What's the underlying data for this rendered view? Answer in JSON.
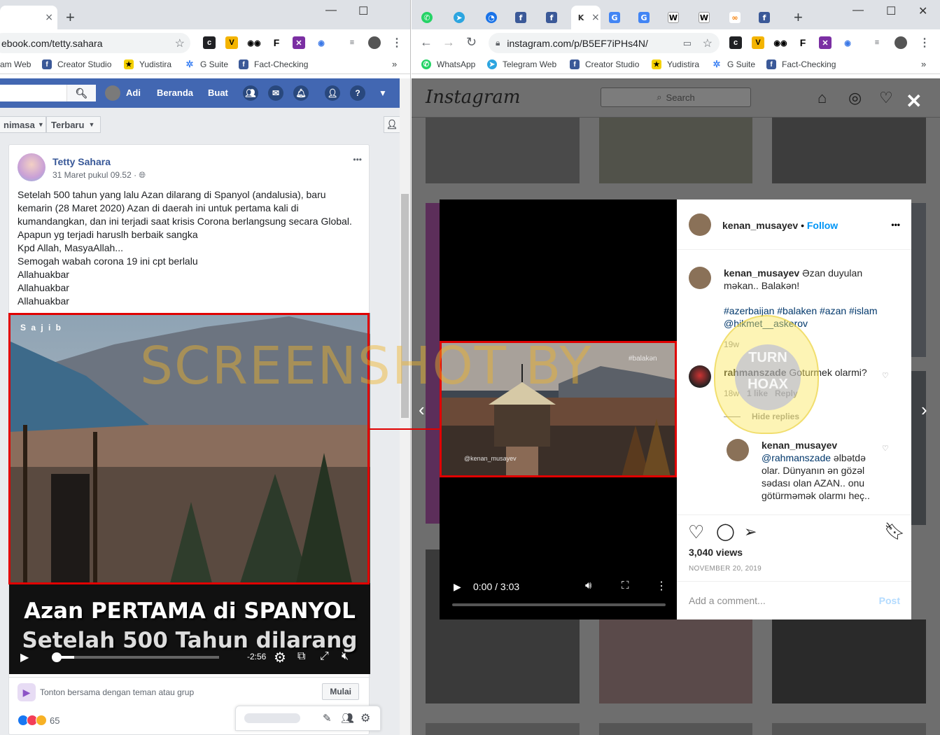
{
  "left_window": {
    "tab": {
      "close": "×",
      "new": "+"
    },
    "window_controls": {
      "minimize": "—",
      "maximize": "☐"
    },
    "url": "ebook.com/tetty.sahara",
    "bookmarks": [
      "am Web",
      "Creator Studio",
      "Yudistira",
      "G Suite",
      "Fact-Checking"
    ],
    "bookmarks_more": "»"
  },
  "facebook": {
    "nav": {
      "user": "Adi",
      "home": "Beranda",
      "create": "Buat"
    },
    "filters": [
      "nimasa",
      "Terbaru"
    ],
    "post": {
      "author": "Tetty Sahara",
      "date": "31 Maret pukul 09.52 · ",
      "more": "•••",
      "text_lines": [
        "Setelah 500 tahun yang lalu Azan dilarang di Spanyol (andalusia), baru",
        "kemarin (28 Maret 2020) Azan di daerah ini untuk pertama kali di",
        "kumandangkan, dan ini terjadi saat krisis Corona berlangsung secara Global.",
        "Apapun yg terjadi haruslh berbaik sangka",
        "Kpd Allah, MasyaAllah...",
        "Semogah wabah corona 19 ini cpt berlalu",
        "Allahuakbar",
        "Allahuakbar",
        "Allahuakbar"
      ],
      "video": {
        "overlay_text": "S a j i b",
        "caption_line1": "Azan PERTAMA di SPANYOL",
        "caption_line2": "Setelah 500 Tahun dilarang",
        "time_remaining": "-2:56",
        "progress": 0.12
      },
      "watch_together": "Tonton bersama dengan teman atau grup",
      "start_button": "Mulai",
      "reaction_count": "65"
    }
  },
  "right_window": {
    "tab_close": "×",
    "new_tab": "+",
    "window_controls": {
      "minimize": "—",
      "maximize": "☐",
      "close": "✕"
    },
    "url": "instagram.com/p/B5EF7iPHs4N/",
    "bookmarks": [
      "WhatsApp",
      "Telegram Web",
      "Creator Studio",
      "Yudistira",
      "G Suite",
      "Fact-Checking"
    ],
    "bookmarks_more": "»"
  },
  "instagram": {
    "logo": "Instagram",
    "search_placeholder": "Search",
    "post": {
      "username": "kenan_musayev",
      "follow": "Follow",
      "separator": "•",
      "more": "•••",
      "caption_user": "kenan_musayev",
      "caption_text": " Əzan duyulan məkan.. Balakən!",
      "hashtags": "#azerbaijan #balaken #azan #islam",
      "mention": "@hikmet__askerov",
      "caption_age": "19w",
      "video_overlay_tag": "#balakən",
      "video_overlay_handle": "@kenan_musayev",
      "video_time": "0:00 / 3:03",
      "comments": [
        {
          "user": "rahmanszade",
          "text": " Goturmek olarmi?",
          "age": "18w",
          "likes": "1 like",
          "reply": "Reply",
          "hide_replies": "Hide replies"
        }
      ],
      "reply": {
        "user": "kenan_musayev",
        "mention": "@rahmanszade",
        "text": " əlbətdə olar. Dünyanın ən gözəl sədası olan AZAN.. onu götürməmək olarmı heç.."
      },
      "views": "3,040 views",
      "date": "NOVEMBER 20, 2019",
      "add_comment_placeholder": "Add a comment...",
      "post_button": "Post"
    }
  },
  "watermark": "SCREENSHOT BY",
  "seal_text": [
    "TURN",
    "HOAX"
  ],
  "colors": {
    "fb_blue": "#4267b2",
    "ig_link": "#0095f6",
    "highlight_red": "#e00000"
  }
}
